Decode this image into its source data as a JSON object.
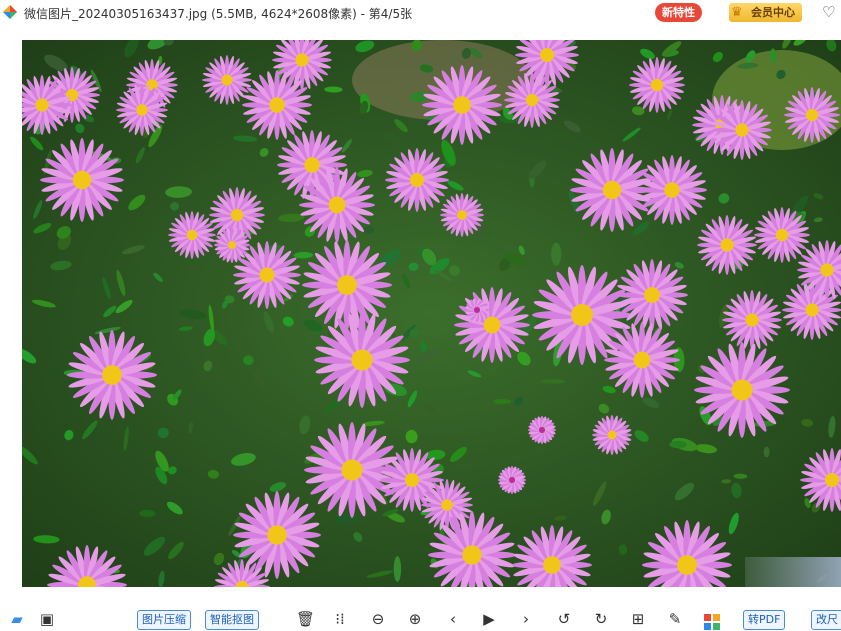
{
  "titlebar": {
    "title": "微信图片_20240305163437.jpg (5.5MB, 4624*2608像素) - 第4/5张",
    "new_feature_label": "新特性",
    "vip_label": "会员中心",
    "icons": {
      "app": "app-logo-icon",
      "crown": "crown-icon",
      "favorite": "heart-icon"
    }
  },
  "viewer": {
    "image_description_icon": "photo"
  },
  "toolbar": {
    "compress_label": "图片压缩",
    "cutout_label": "智能抠图",
    "to_pdf_label": "转PDF",
    "rename_label": "改尺",
    "icons": [
      "folder-icon",
      "image-gallery-icon",
      "delete-icon",
      "actual-size-icon",
      "zoom-out-icon",
      "zoom-in-icon",
      "previous-icon",
      "slideshow-icon",
      "next-icon",
      "rotate-left-icon",
      "rotate-right-icon",
      "image-edit-icon",
      "edit-icon",
      "apps-grid-icon"
    ]
  },
  "colors": {
    "accent": "#1e5fb8",
    "badge_red": "#e8483a",
    "vip_gold": "#f0b72f"
  }
}
